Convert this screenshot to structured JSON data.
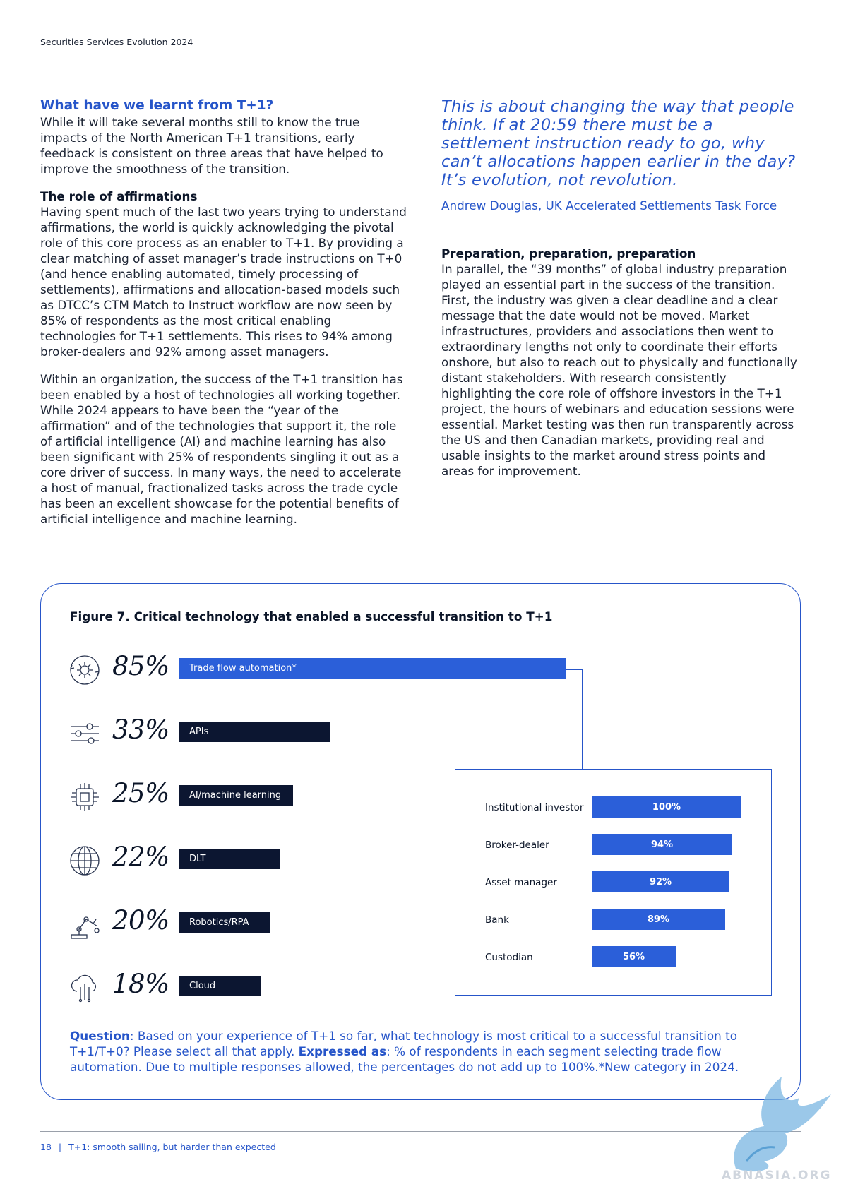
{
  "header": {
    "title": "Securities Services Evolution 2024"
  },
  "left_column": {
    "heading": "What have we learnt from T+1?",
    "intro": "While it will take several months still to know the true impacts of the North American T+1 transitions, early feedback is consistent on three areas that have helped to improve the smoothness of the transition.",
    "affirmations_heading": "The role of affirmations",
    "affirmations_body": "Having spent much of the last two years trying to understand affirmations, the world is quickly acknowledging the pivotal role of this core process as an enabler to T+1. By providing a clear matching of asset manager’s trade instructions on T+0 (and hence enabling automated, timely processing of settlements), affirmations and allocation-based models such as DTCC’s CTM Match to Instruct workflow are now seen by 85% of respondents as the most critical enabling technologies for T+1 settlements. This rises to 94% among broker-dealers and 92% among asset managers.",
    "organization_body": "Within an organization, the success of the T+1 transition has been enabled by a host of technologies all working together. While 2024 appears to have been the “year of the affirmation” and of the technologies that support it, the role of artificial intelligence (AI) and machine learning has also been significant with 25% of respondents singling it out as a core driver of success. In many ways, the need to accelerate a host of manual, fractionalized tasks across the trade cycle has been an excellent showcase for the potential benefits of artificial intelligence and machine learning."
  },
  "right_column": {
    "quote": "This is about changing the way that people think. If at 20:59 there must be a settlement instruction ready to go, why can’t allocations happen earlier in the day? It’s evolution, not revolution.",
    "quote_attribution": "Andrew Douglas, UK Accelerated Settlements Task Force",
    "preparation_heading": "Preparation, preparation, preparation",
    "preparation_body": "In parallel, the “39 months” of global industry preparation played an essential part in the success of the transition. First, the industry was given a clear deadline and a clear message that the date would not be moved. Market infrastructures, providers and associations then went to extraordinary lengths not only to coordinate their efforts onshore, but also to reach out to physically and functionally distant stakeholders. With research consistently highlighting the core role of offshore investors in the T+1 project, the hours of webinars and education sessions were essential. Market testing was then run transparently across the US and then Canadian markets, providing real and usable insights to the market around stress points and areas for improvement."
  },
  "figure": {
    "title": "Figure 7. Critical technology that enabled a successful transition to T+1",
    "question_label": "Question",
    "question_text": ": Based on your experience of T+1 so far, what technology is most critical to a successful transition to T+1/T+0? Please select all that apply. ",
    "expressed_label": "Expressed as",
    "expressed_text": ": % of respondents in each segment selecting trade flow automation. Due to multiple responses allowed, the percentages do not add up to 100%.*New category in 2024."
  },
  "chart_data": [
    {
      "type": "bar",
      "title": "Figure 7. Critical technology that enabled a successful transition to T+1",
      "categories": [
        "Trade flow automation*",
        "APIs",
        "AI/machine learning",
        "DLT",
        "Robotics/RPA",
        "Cloud"
      ],
      "values": [
        85,
        33,
        25,
        22,
        20,
        18
      ],
      "value_labels": [
        "85%",
        "33%",
        "25%",
        "22%",
        "20%",
        "18%"
      ],
      "icons": [
        "gear-cycle-icon",
        "sliders-icon",
        "chip-icon",
        "globe-icon",
        "robot-arm-icon",
        "cloud-icon"
      ],
      "colors": {
        "highlight": "#2b5fd9",
        "default": "#0c1631"
      },
      "ylim": [
        0,
        100
      ]
    },
    {
      "type": "bar",
      "categories": [
        "Institutional investor",
        "Broker-dealer",
        "Asset manager",
        "Bank",
        "Custodian"
      ],
      "values": [
        100,
        94,
        92,
        89,
        56
      ],
      "value_labels": [
        "100%",
        "94%",
        "92%",
        "89%",
        "56%"
      ],
      "colors": {
        "bar": "#2b5fd9"
      },
      "ylim": [
        0,
        100
      ]
    }
  ],
  "footer": {
    "page_number": "18",
    "separator": "|",
    "section": "T+1: smooth sailing, but harder than expected"
  },
  "watermark": {
    "text": "ABNASIA.ORG"
  }
}
